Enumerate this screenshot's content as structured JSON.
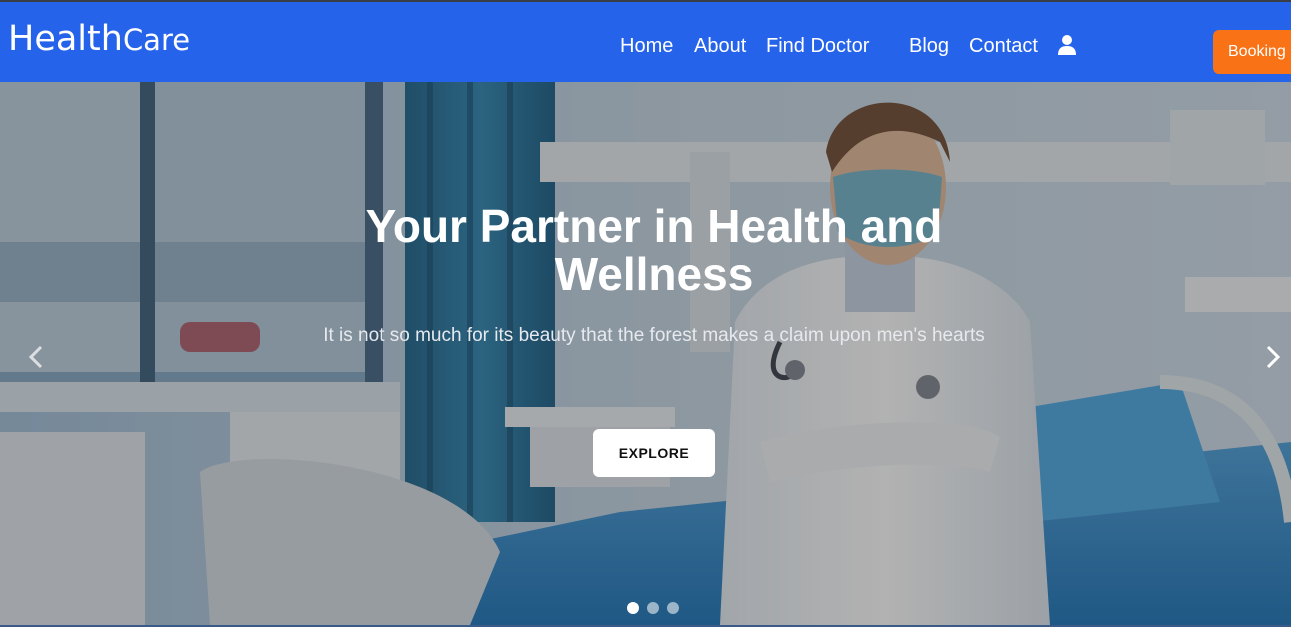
{
  "brand": {
    "part1": "Health",
    "part2": "Care"
  },
  "nav": {
    "home": "Home",
    "about": "About",
    "find_doctor": "Find Doctor",
    "blog": "Blog",
    "contact": "Contact",
    "user_icon": "user-icon",
    "booking": "Booking"
  },
  "hero": {
    "title": "Your Partner in Health and Wellness",
    "subtitle": "It is not so much for its beauty that the forest makes a claim upon men's hearts",
    "button": "EXPLORE",
    "prev_icon": "chevron-left-icon",
    "next_icon": "chevron-right-icon",
    "slides_total": 3,
    "active_slide": 1
  },
  "colors": {
    "header_bg": "#2563eb",
    "booking_bg": "#f97316",
    "text_on_dark": "#ffffff"
  }
}
